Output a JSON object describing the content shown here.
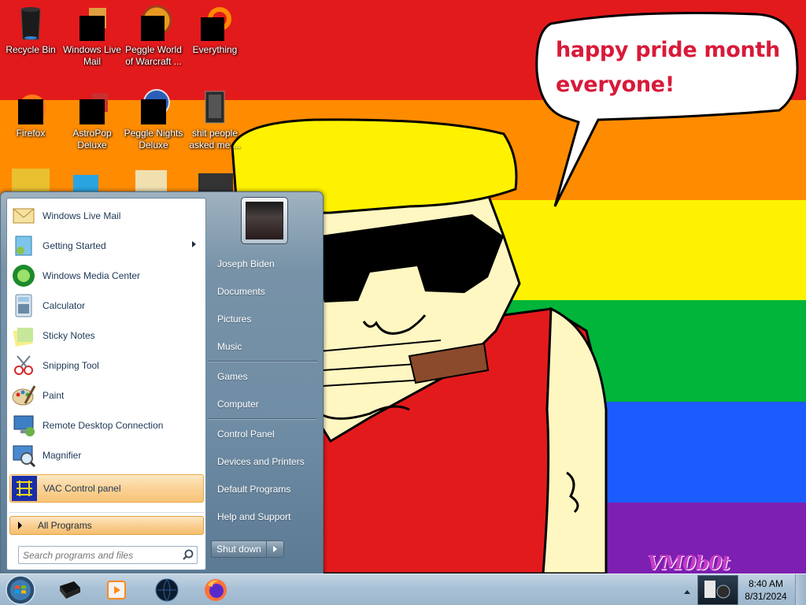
{
  "wallpaper": {
    "speech_bubble_lines": [
      "happy pride month",
      "everyone!"
    ],
    "signature": "VM0b0t",
    "colors": {
      "red": "#e31a1c",
      "orange": "#ff8c00",
      "yellow": "#fff200",
      "green": "#00b53a",
      "blue": "#1c5cff",
      "purple": "#7d1fb0",
      "speech_text": "#d81a3a"
    }
  },
  "desktop_icons": [
    {
      "label": "Recycle Bin",
      "icon": "recycle-bin-icon"
    },
    {
      "label": "Windows Live\nMail",
      "icon": "windows-live-mail-icon"
    },
    {
      "label": "Peggle World\nof Warcraft ...",
      "icon": "peggle-world-of-warcraft-icon"
    },
    {
      "label": "Everything",
      "icon": "everything-search-icon"
    },
    {
      "label": "Firefox",
      "icon": "firefox-icon"
    },
    {
      "label": "AstroPop\nDeluxe",
      "icon": "astropop-icon"
    },
    {
      "label": "Peggle Nights\nDeluxe",
      "icon": "peggle-nights-icon"
    },
    {
      "label": "shit people\nasked me ...",
      "icon": "file-shortcut-icon"
    }
  ],
  "start_menu": {
    "programs": [
      {
        "label": "Windows Live Mail",
        "icon": "windows-live-mail-icon"
      },
      {
        "label": "Getting Started",
        "icon": "getting-started-icon",
        "submenu": true
      },
      {
        "label": "Windows Media Center",
        "icon": "media-center-icon"
      },
      {
        "label": "Calculator",
        "icon": "calculator-icon"
      },
      {
        "label": "Sticky Notes",
        "icon": "sticky-notes-icon"
      },
      {
        "label": "Snipping Tool",
        "icon": "snipping-tool-icon"
      },
      {
        "label": "Paint",
        "icon": "paint-icon"
      },
      {
        "label": "Remote Desktop Connection",
        "icon": "remote-desktop-icon"
      },
      {
        "label": "Magnifier",
        "icon": "magnifier-icon"
      },
      {
        "label": "VAC Control panel",
        "icon": "vac-control-panel-icon",
        "highlighted": true
      }
    ],
    "all_programs": "All Programs",
    "search": {
      "placeholder": "Search programs and files",
      "value": ""
    },
    "right_items": [
      {
        "label": "Joseph Biden"
      },
      {
        "label": "Documents"
      },
      {
        "label": "Pictures"
      },
      {
        "label": "Music"
      },
      {
        "label": "Games"
      },
      {
        "label": "Computer"
      },
      {
        "label": "Control Panel"
      },
      {
        "label": "Devices and Printers"
      },
      {
        "label": "Default Programs"
      },
      {
        "label": "Help and Support"
      }
    ],
    "shutdown_label": "Shut down"
  },
  "taskbar": {
    "pinned": [
      {
        "name": "black-window-app-icon"
      },
      {
        "name": "media-player-icon"
      },
      {
        "name": "black-globe-app-icon"
      },
      {
        "name": "firefox-icon"
      }
    ],
    "clock": {
      "time": "8:40 AM",
      "date": "8/31/2024"
    }
  }
}
